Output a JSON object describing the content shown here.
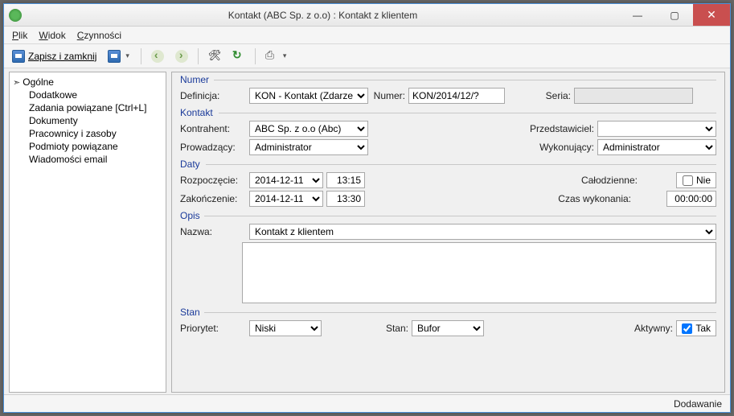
{
  "title": "Kontakt (ABC Sp. z o.o) : Kontakt z klientem",
  "menu": {
    "plik": "Plik",
    "widok": "Widok",
    "czynnosci": "Czynności"
  },
  "toolbar": {
    "save_close": "Zapisz i zamknij"
  },
  "nav": {
    "items": [
      "Ogólne",
      "Dodatkowe",
      "Zadania powiązane [Ctrl+L]",
      "Dokumenty",
      "Pracownicy i zasoby",
      "Podmioty powiązane",
      "Wiadomości email"
    ]
  },
  "groups": {
    "numer": "Numer",
    "kontakt": "Kontakt",
    "daty": "Daty",
    "opis": "Opis",
    "stan": "Stan"
  },
  "labels": {
    "definicja": "Definicja:",
    "numer": "Numer:",
    "seria": "Seria:",
    "kontrahent": "Kontrahent:",
    "przedstawiciel": "Przedstawiciel:",
    "prowadzacy": "Prowadzący:",
    "wykonujacy": "Wykonujący:",
    "rozpoczecie": "Rozpoczęcie:",
    "zakonczenie": "Zakończenie:",
    "calodzienne": "Całodzienne:",
    "czas_wykonania": "Czas wykonania:",
    "nazwa": "Nazwa:",
    "priorytet": "Priorytet:",
    "stan": "Stan:",
    "aktywny": "Aktywny:"
  },
  "values": {
    "definicja": "KON - Kontakt (Zdarzenie)",
    "numer": "KON/2014/12/?",
    "seria": "",
    "kontrahent": "ABC Sp. z o.o (Abc)",
    "przedstawiciel": "",
    "prowadzacy": "Administrator",
    "wykonujacy": "Administrator",
    "rozp_data": "2014-12-11",
    "rozp_czas": "13:15",
    "zak_data": "2014-12-11",
    "zak_czas": "13:30",
    "calodzienne": "Nie",
    "czas_wykonania": "00:00:00",
    "nazwa": "Kontakt z klientem",
    "opis": "",
    "priorytet": "Niski",
    "stan": "Bufor",
    "aktywny": "Tak"
  },
  "status": "Dodawanie"
}
